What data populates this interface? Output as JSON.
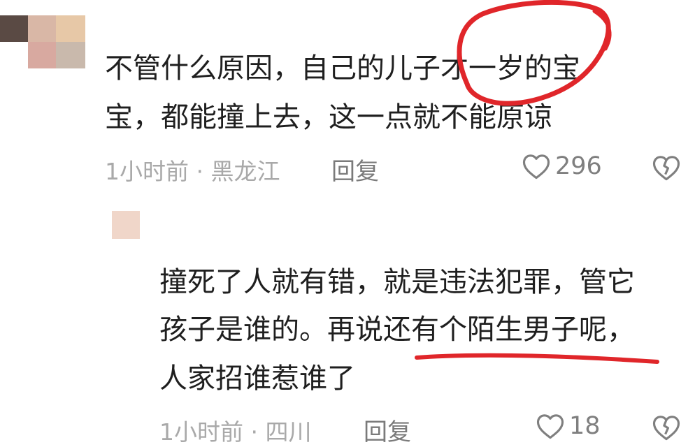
{
  "comments": [
    {
      "username": "",
      "lines": [
        "不管什么原因，自己的儿子才一岁的宝",
        "宝，都能撞上去，这一点就不能原谅"
      ],
      "time_location": "1小时前 · 黑龙江",
      "reply_label": "回复",
      "likes": "296",
      "icons": {
        "like": "heart-icon",
        "dislike": "broken-heart-icon"
      }
    },
    {
      "username": "",
      "lines": [
        "撞死了人就有错，就是违法犯罪，管它",
        "孩子是谁的。再说还有个陌生男子呢，",
        "人家招谁惹谁了"
      ],
      "time_location": "1小时前 · 四川",
      "reply_label": "回复",
      "likes": "18",
      "icons": {
        "like": "heart-icon",
        "dislike": "broken-heart-icon"
      }
    }
  ],
  "colors": {
    "text": "#1f1f1f",
    "meta": "#a9a9a9",
    "reply": "#7a7a7a",
    "annotation": "#e0262a"
  }
}
